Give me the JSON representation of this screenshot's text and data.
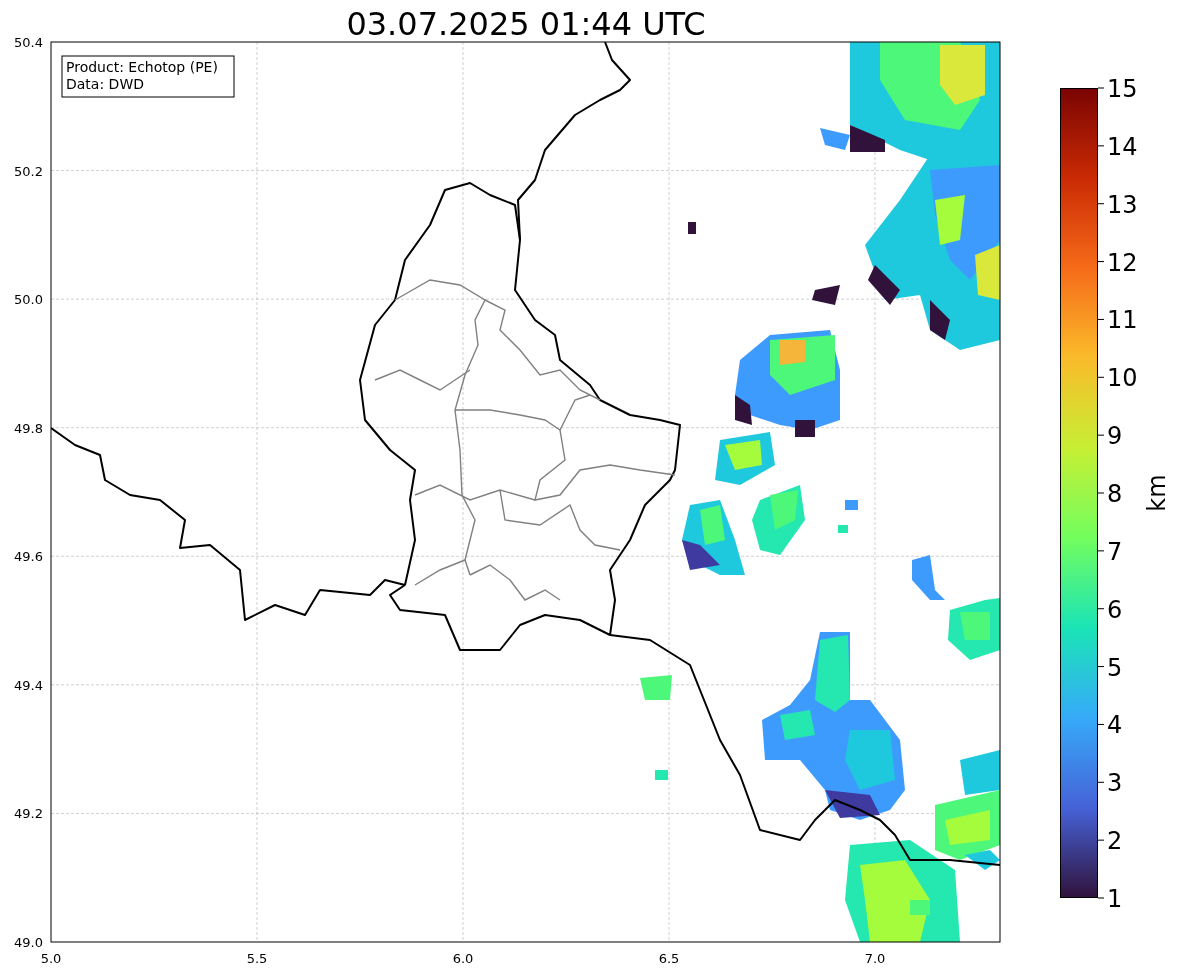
{
  "title": "03.07.2025 01:44 UTC",
  "map": {
    "legend": [
      "Product: Echotop (PE)",
      "Data: DWD"
    ],
    "x_tick_labels": [
      "5.0",
      "5.5",
      "6.0",
      "6.5",
      "7.0"
    ],
    "y_tick_labels": [
      "50.4",
      "50.2",
      "50.0",
      "49.8",
      "49.6",
      "49.4",
      "49.2",
      "49.0"
    ]
  },
  "colorbar": {
    "label": "km",
    "tick_labels": [
      "15",
      "14",
      "13",
      "12",
      "11",
      "10",
      "9",
      "8",
      "7",
      "6",
      "5",
      "4",
      "3",
      "2",
      "1"
    ]
  }
}
